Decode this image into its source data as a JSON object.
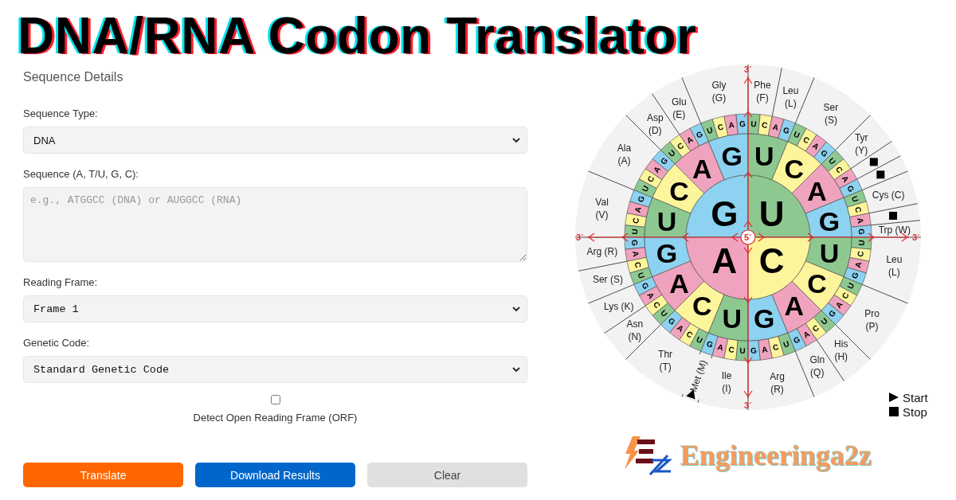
{
  "title": "DNA/RNA Codon Translator",
  "form": {
    "heading": "Sequence Details",
    "fields": [
      {
        "kind": "select",
        "label": "Sequence Type:",
        "value": "DNA"
      },
      {
        "kind": "textarea",
        "label": "Sequence (A, T/U, G, C):",
        "placeholder": "e.g., ATGGCC (DNA) or AUGGCC (RNA)"
      },
      {
        "kind": "mono-select",
        "label": "Reading Frame:",
        "value": "Frame 1"
      },
      {
        "kind": "mono-select",
        "label": "Genetic Code:",
        "value": "Standard Genetic Code"
      }
    ],
    "orf": {
      "label": "Detect Open Reading Frame (ORF)",
      "checked": false
    },
    "buttons": [
      {
        "label": "Translate",
        "color": "#ff6600"
      },
      {
        "label": "Download Results",
        "color": "#0066cc"
      },
      {
        "label": "Clear",
        "color": "#e0e0e0"
      }
    ]
  },
  "codon_wheel": {
    "end_labels": [
      "3´",
      "3´",
      "3´",
      "3´"
    ],
    "center_label": "5´",
    "left_half": {
      "first_base": [
        {
          "base": "G",
          "color": "#8dd2f0"
        },
        {
          "base": "A",
          "color": "#f0a3be"
        }
      ],
      "second_base": [
        {
          "base": "G",
          "color": "#8dd2f0"
        },
        {
          "base": "A",
          "color": "#f0a3be"
        },
        {
          "base": "C",
          "color": "#fdf59b"
        },
        {
          "base": "U",
          "color": "#8ec891"
        },
        {
          "base": "G",
          "color": "#8dd2f0"
        },
        {
          "base": "A",
          "color": "#f0a3be"
        },
        {
          "base": "C",
          "color": "#fdf59b"
        },
        {
          "base": "U",
          "color": "#8ec891"
        }
      ],
      "third_base": [
        {
          "base": "G",
          "color": "#8dd2f0"
        },
        {
          "base": "A",
          "color": "#f0a3be"
        },
        {
          "base": "C",
          "color": "#fdf59b"
        },
        {
          "base": "U",
          "color": "#8ec891"
        },
        {
          "base": "G",
          "color": "#8dd2f0"
        },
        {
          "base": "A",
          "color": "#f0a3be"
        },
        {
          "base": "C",
          "color": "#fdf59b"
        },
        {
          "base": "U",
          "color": "#8ec891"
        },
        {
          "base": "G",
          "color": "#8dd2f0"
        },
        {
          "base": "A",
          "color": "#f0a3be"
        },
        {
          "base": "C",
          "color": "#fdf59b"
        },
        {
          "base": "U",
          "color": "#8ec891"
        },
        {
          "base": "G",
          "color": "#8dd2f0"
        },
        {
          "base": "A",
          "color": "#f0a3be"
        },
        {
          "base": "C",
          "color": "#fdf59b"
        },
        {
          "base": "U",
          "color": "#8ec891"
        },
        {
          "base": "G",
          "color": "#8dd2f0"
        },
        {
          "base": "A",
          "color": "#f0a3be"
        },
        {
          "base": "C",
          "color": "#fdf59b"
        },
        {
          "base": "U",
          "color": "#8ec891"
        },
        {
          "base": "G",
          "color": "#8dd2f0"
        },
        {
          "base": "A",
          "color": "#f0a3be"
        },
        {
          "base": "C",
          "color": "#fdf59b"
        },
        {
          "base": "U",
          "color": "#8ec891"
        },
        {
          "base": "G",
          "color": "#8dd2f0"
        },
        {
          "base": "A",
          "color": "#f0a3be"
        },
        {
          "base": "C",
          "color": "#fdf59b"
        },
        {
          "base": "U",
          "color": "#8ec891"
        },
        {
          "base": "G",
          "color": "#8dd2f0"
        },
        {
          "base": "A",
          "color": "#f0a3be"
        },
        {
          "base": "C",
          "color": "#fdf59b"
        },
        {
          "base": "U",
          "color": "#8ec891"
        }
      ],
      "amino_acids": [
        {
          "kind": "amino",
          "name": "Gly",
          "code": "(G)"
        },
        {
          "kind": "amino",
          "name": "Glu",
          "code": "(E)"
        },
        {
          "kind": "amino",
          "name": "Asp",
          "code": "(D)"
        },
        {
          "kind": "amino",
          "name": "Ala",
          "code": "(A)"
        },
        {
          "kind": "amino",
          "name": "Val",
          "code": "(V)"
        },
        {
          "kind": "amino",
          "name": "Arg",
          "code": "(R)"
        },
        {
          "kind": "amino",
          "name": "Ser",
          "code": "(S)"
        },
        {
          "kind": "amino",
          "name": "Lys",
          "code": "(K)"
        },
        {
          "kind": "amino",
          "name": "Asn",
          "code": "(N)"
        },
        {
          "kind": "amino",
          "name": "Thr",
          "code": "(T)"
        },
        {
          "kind": "start",
          "name": "Met",
          "code": "(M)"
        },
        {
          "kind": "amino",
          "name": "Ile",
          "code": "(I)"
        }
      ]
    },
    "right_half": {
      "first_base": [
        {
          "base": "U",
          "color": "#8ec891"
        },
        {
          "base": "C",
          "color": "#fdf59b"
        }
      ],
      "second_base": [
        {
          "base": "U",
          "color": "#8ec891"
        },
        {
          "base": "C",
          "color": "#fdf59b"
        },
        {
          "base": "A",
          "color": "#f0a3be"
        },
        {
          "base": "G",
          "color": "#8dd2f0"
        },
        {
          "base": "U",
          "color": "#8ec891"
        },
        {
          "base": "C",
          "color": "#fdf59b"
        },
        {
          "base": "A",
          "color": "#f0a3be"
        },
        {
          "base": "G",
          "color": "#8dd2f0"
        }
      ],
      "third_base": [
        {
          "base": "U",
          "color": "#8ec891"
        },
        {
          "base": "C",
          "color": "#fdf59b"
        },
        {
          "base": "A",
          "color": "#f0a3be"
        },
        {
          "base": "G",
          "color": "#8dd2f0"
        },
        {
          "base": "U",
          "color": "#8ec891"
        },
        {
          "base": "C",
          "color": "#fdf59b"
        },
        {
          "base": "A",
          "color": "#f0a3be"
        },
        {
          "base": "G",
          "color": "#8dd2f0"
        },
        {
          "base": "U",
          "color": "#8ec891"
        },
        {
          "base": "C",
          "color": "#fdf59b"
        },
        {
          "base": "A",
          "color": "#f0a3be"
        },
        {
          "base": "G",
          "color": "#8dd2f0"
        },
        {
          "base": "U",
          "color": "#8ec891"
        },
        {
          "base": "C",
          "color": "#fdf59b"
        },
        {
          "base": "A",
          "color": "#f0a3be"
        },
        {
          "base": "G",
          "color": "#8dd2f0"
        },
        {
          "base": "U",
          "color": "#8ec891"
        },
        {
          "base": "C",
          "color": "#fdf59b"
        },
        {
          "base": "A",
          "color": "#f0a3be"
        },
        {
          "base": "G",
          "color": "#8dd2f0"
        },
        {
          "base": "U",
          "color": "#8ec891"
        },
        {
          "base": "C",
          "color": "#fdf59b"
        },
        {
          "base": "A",
          "color": "#f0a3be"
        },
        {
          "base": "G",
          "color": "#8dd2f0"
        },
        {
          "base": "U",
          "color": "#8ec891"
        },
        {
          "base": "C",
          "color": "#fdf59b"
        },
        {
          "base": "A",
          "color": "#f0a3be"
        },
        {
          "base": "G",
          "color": "#8dd2f0"
        },
        {
          "base": "U",
          "color": "#8ec891"
        },
        {
          "base": "C",
          "color": "#fdf59b"
        },
        {
          "base": "A",
          "color": "#f0a3be"
        },
        {
          "base": "G",
          "color": "#8dd2f0"
        }
      ],
      "amino_acids": [
        {
          "kind": "amino",
          "name": "Phe",
          "code": "(F)"
        },
        {
          "kind": "amino",
          "name": "Leu",
          "code": "(L)"
        },
        {
          "kind": "amino",
          "name": "Ser",
          "code": "(S)"
        },
        {
          "kind": "amino",
          "name": "Tyr",
          "code": "(Y)"
        },
        {
          "kind": "stop"
        },
        {
          "kind": "stop"
        },
        {
          "kind": "amino",
          "name": "Cys",
          "code": "(C)"
        },
        {
          "kind": "stop"
        },
        {
          "kind": "amino",
          "name": "Trp",
          "code": "(W)"
        },
        {
          "kind": "amino",
          "name": "Leu",
          "code": "(L)"
        },
        {
          "kind": "amino",
          "name": "Pro",
          "code": "(P)"
        },
        {
          "kind": "amino",
          "name": "His",
          "code": "(H)"
        },
        {
          "kind": "amino",
          "name": "Gln",
          "code": "(Q)"
        },
        {
          "kind": "amino",
          "name": "Arg",
          "code": "(R)"
        }
      ]
    },
    "legend": [
      {
        "kind": "start",
        "label": "Start"
      },
      {
        "kind": "stop",
        "label": "Stop"
      }
    ]
  },
  "logo": "Engineeringa2z"
}
